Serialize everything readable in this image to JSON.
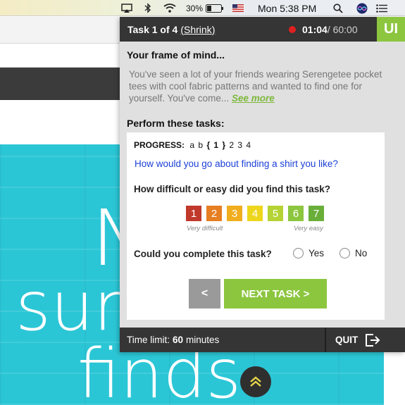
{
  "menubar": {
    "battery_percent": "30%",
    "clock": "Mon 5:38 PM"
  },
  "hero": {
    "line1": "N",
    "line2": "sum",
    "line3": "finds"
  },
  "panel": {
    "task_title": "Task 1 of 4",
    "shrink_label": "Shrink",
    "timer_elapsed": "01:04",
    "timer_total": " / 60:00",
    "logo": "UI",
    "frame_title": "Your frame of mind...",
    "frame_text": "You've seen a lot of your friends wearing Serengetee pocket tees with cool fabric patterns and wanted to find one for yourself. You've come...",
    "see_more": "See more",
    "perform_title": "Perform these tasks:",
    "progress_label": "PROGRESS:",
    "progress_before": "a b ",
    "progress_current": "{ 1 }",
    "progress_after": " 2 3 4",
    "task_question": "How would you go about finding a shirt you like?",
    "difficulty_question": "How difficult or easy did you find this task?",
    "ratings": [
      {
        "label": "1",
        "color": "#c0392b"
      },
      {
        "label": "2",
        "color": "#e67e22"
      },
      {
        "label": "3",
        "color": "#f0ad1e"
      },
      {
        "label": "4",
        "color": "#eed61c"
      },
      {
        "label": "5",
        "color": "#b5d334"
      },
      {
        "label": "6",
        "color": "#8cc63f"
      },
      {
        "label": "7",
        "color": "#6aae3a"
      }
    ],
    "very_difficult": "Very difficult",
    "very_easy": "Very easy",
    "complete_question": "Could you complete this task?",
    "yes_label": "Yes",
    "no_label": "No",
    "back_label": "<",
    "next_label": "NEXT TASK >",
    "time_limit_label": "Time limit:",
    "time_limit_value": "60",
    "time_limit_unit": "minutes",
    "quit_label": "QUIT"
  },
  "colors": {
    "accent_green": "#8cc63f",
    "header_dark": "#353535",
    "hero_cyan": "#2bc6d6",
    "recording_red": "#e02020"
  }
}
